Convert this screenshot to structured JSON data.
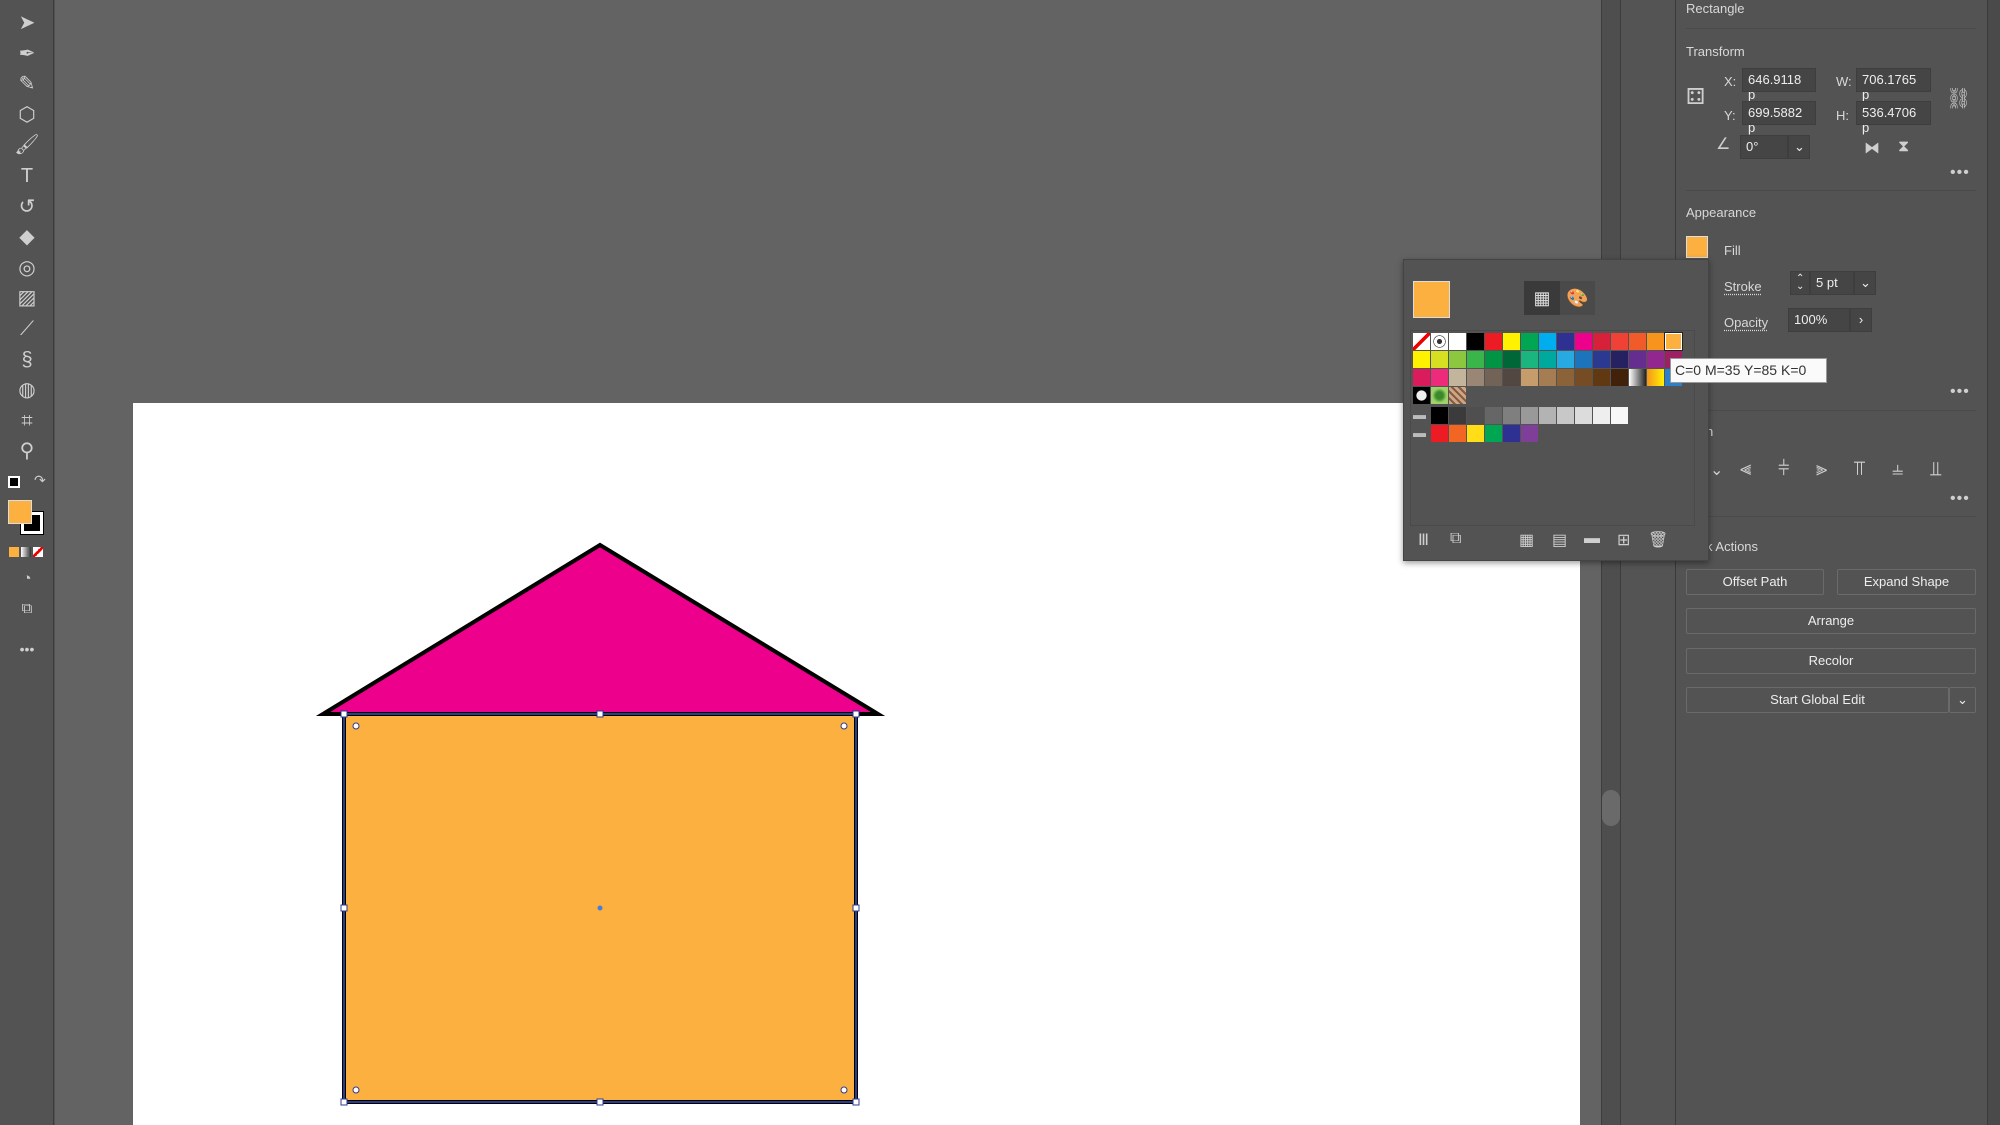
{
  "toolbar": {
    "tools": [
      {
        "name": "selection-tool-icon",
        "glyph": "➤"
      },
      {
        "name": "pen-tool-icon",
        "glyph": "✒"
      },
      {
        "name": "curvature-tool-icon",
        "glyph": "✎"
      },
      {
        "name": "shape-tool-icon",
        "glyph": "⬡"
      },
      {
        "name": "paintbrush-tool-icon",
        "glyph": "🖌"
      },
      {
        "name": "type-tool-icon",
        "glyph": "T"
      },
      {
        "name": "rotate-tool-icon",
        "glyph": "↺"
      },
      {
        "name": "eraser-tool-icon",
        "glyph": "◆"
      },
      {
        "name": "shape-builder-tool-icon",
        "glyph": "◎"
      },
      {
        "name": "gradient-tool-icon",
        "glyph": "▨"
      },
      {
        "name": "eyedropper-tool-icon",
        "glyph": "⟋"
      },
      {
        "name": "puppet-warp-tool-icon",
        "glyph": "§"
      },
      {
        "name": "symbol-sprayer-tool-icon",
        "glyph": "◍"
      },
      {
        "name": "artboard-tool-icon",
        "glyph": "⌗"
      },
      {
        "name": "zoom-tool-icon",
        "glyph": "⚲"
      }
    ],
    "more": "•••",
    "fill_color": "#FBB040",
    "stroke_color": "#000000"
  },
  "artwork": {
    "roof_color": "#EC008C",
    "body_color": "#FBB040",
    "stroke_color": "#000000"
  },
  "properties": {
    "title": "Rectangle",
    "transform": {
      "heading": "Transform",
      "x_label": "X:",
      "x": "646.9118 p",
      "y_label": "Y:",
      "y": "699.5882 p",
      "w_label": "W:",
      "w": "706.1765 p",
      "h_label": "H:",
      "h": "536.4706 p",
      "angle": "0°"
    },
    "appearance": {
      "heading": "Appearance",
      "fill_label": "Fill",
      "fill_color": "#FBB040",
      "stroke_label": "Stroke",
      "stroke_value": "5 pt",
      "opacity_label": "Opacity",
      "opacity_value": "100%"
    },
    "align": {
      "heading_fragment": "n"
    },
    "quick_actions": {
      "heading": "k Actions",
      "offset_path": "Offset Path",
      "expand_shape": "Expand Shape",
      "arrange": "Arrange",
      "recolor": "Recolor",
      "start_global_edit": "Start Global Edit"
    },
    "more": "•••"
  },
  "swatches": {
    "current": "#FBB040",
    "rows": [
      [
        "none",
        "registration",
        "#FFFFFF",
        "#000000",
        "#ED1C24",
        "#FFF200",
        "#00A651",
        "#00AEEF",
        "#2E3192",
        "#EC008C",
        "#D7203A",
        "#EF4136",
        "#F15A29",
        "#F7941D",
        "#FBB040"
      ],
      [
        "#FFF200",
        "#D7DF23",
        "#8DC63F",
        "#39B54A",
        "#009444",
        "#006838",
        "#1BB57F",
        "#00A99D",
        "#27AAE1",
        "#1C75BC",
        "#2B3990",
        "#262262",
        "#662D91",
        "#92278F",
        "#9E1F63"
      ],
      [
        "#DA1C5C",
        "#EE2A7B",
        "#C2B59B",
        "#998675",
        "#736357",
        "#534741",
        "#C69C6D",
        "#A67C52",
        "#8C6239",
        "#754C24",
        "#603913",
        "#42210B",
        "gradient-gray",
        "gradient-orange",
        "#2980CC"
      ],
      [
        "pattern-dots",
        "pattern-leaf",
        "pattern-texture"
      ]
    ],
    "group_gray": [
      "#000000",
      "#3B3B3B",
      "#4F4F4F",
      "#666666",
      "#7F7F7F",
      "#999999",
      "#B3B3B3",
      "#C8C8C8",
      "#DCDCDC",
      "#EEEEEE",
      "#F7F7F7"
    ],
    "group_bright": [
      "#ED1C24",
      "#F26522",
      "#FFDE17",
      "#00A651",
      "#2E3192",
      "#7F3F98"
    ],
    "tooltip": "C=0 M=35 Y=85 K=0"
  }
}
